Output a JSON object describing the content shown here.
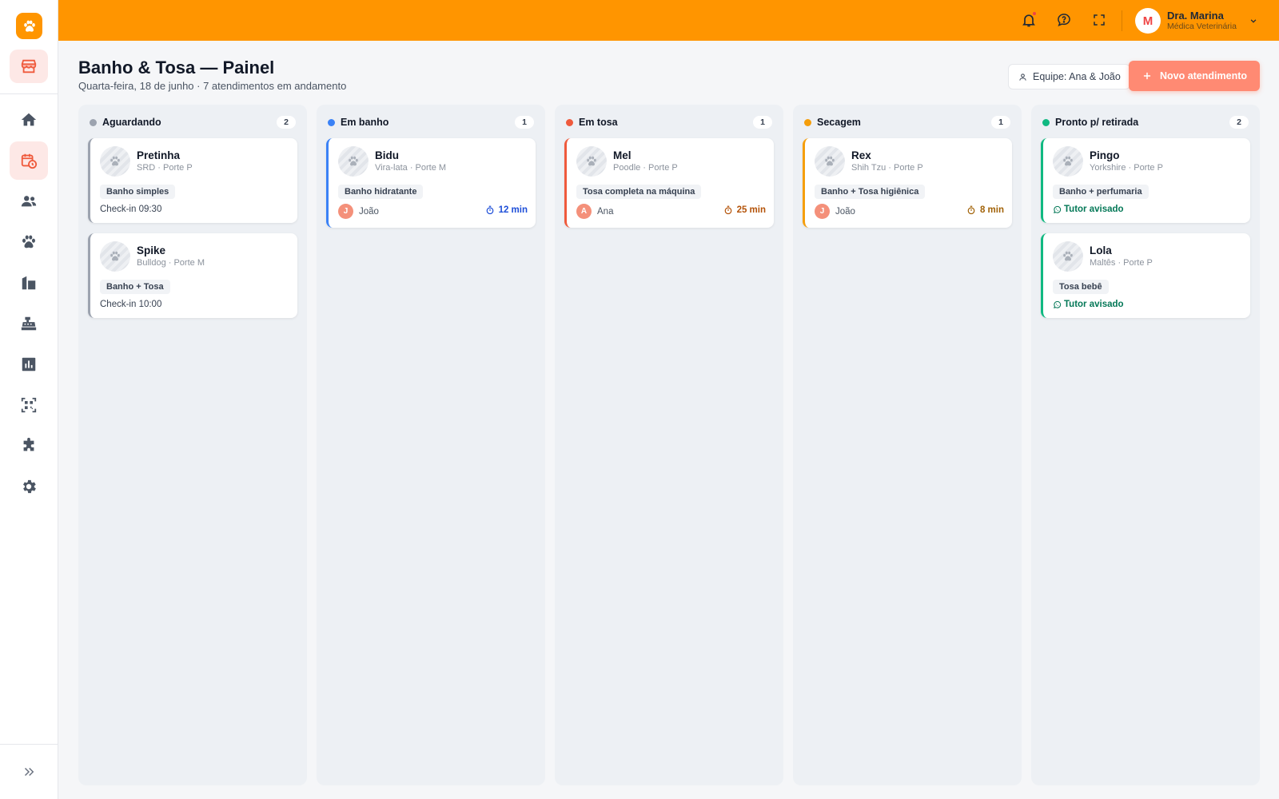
{
  "topbar": {
    "user": {
      "initial": "M",
      "name": "Dra. Marina",
      "role": "Médica Veterinária"
    }
  },
  "sidebar": {
    "items": [
      {
        "icon": "home-icon",
        "active": false
      },
      {
        "icon": "calendar-clock-icon",
        "active": true
      },
      {
        "icon": "users-icon",
        "active": false
      },
      {
        "icon": "paw-icon",
        "active": false
      },
      {
        "icon": "building-icon",
        "active": false
      },
      {
        "icon": "cash-register-icon",
        "active": false
      },
      {
        "icon": "chart-icon",
        "active": false
      },
      {
        "icon": "qr-code-icon",
        "active": false
      },
      {
        "icon": "puzzle-icon",
        "active": false
      },
      {
        "icon": "gear-icon",
        "active": false
      }
    ]
  },
  "header": {
    "title": "Banho & Tosa — Painel",
    "subtitle": "Quarta-feira, 18 de junho · 7 atendimentos em andamento",
    "team_label": "Equipe: Ana & João",
    "new_label": "Novo atendimento"
  },
  "columns": [
    {
      "title": "Aguardando",
      "count": "2",
      "color": "#9ca3af",
      "cards": [
        {
          "name": "Pretinha",
          "meta": "SRD · Porte P",
          "service": "Banho simples",
          "checkin": "Check-in 09:30"
        },
        {
          "name": "Spike",
          "meta": "Bulldog · Porte M",
          "service": "Banho + Tosa",
          "checkin": "Check-in 10:00"
        }
      ]
    },
    {
      "title": "Em banho",
      "count": "1",
      "color": "#3b82f6",
      "cards": [
        {
          "name": "Bidu",
          "meta": "Vira-lata · Porte M",
          "service": "Banho hidratante",
          "groomer_initial": "J",
          "groomer": "João",
          "timer": "12 min",
          "timer_color": "#1d4ed8"
        }
      ]
    },
    {
      "title": "Em tosa",
      "count": "1",
      "color": "#ef5a3c",
      "cards": [
        {
          "name": "Mel",
          "meta": "Poodle · Porte P",
          "service": "Tosa completa na máquina",
          "groomer_initial": "A",
          "groomer": "Ana",
          "timer": "25 min",
          "timer_color": "#b45309"
        }
      ]
    },
    {
      "title": "Secagem",
      "count": "1",
      "color": "#f59e0b",
      "cards": [
        {
          "name": "Rex",
          "meta": "Shih Tzu · Porte P",
          "service": "Banho + Tosa higiênica",
          "groomer_initial": "J",
          "groomer": "João",
          "timer": "8 min",
          "timer_color": "#a16207"
        }
      ]
    },
    {
      "title": "Pronto p/ retirada",
      "count": "2",
      "color": "#10b981",
      "cards": [
        {
          "name": "Pingo",
          "meta": "Yorkshire · Porte P",
          "service": "Banho + perfumaria",
          "notified": "Tutor avisado"
        },
        {
          "name": "Lola",
          "meta": "Maltês · Porte P",
          "service": "Tosa bebê",
          "notified": "Tutor avisado"
        }
      ]
    }
  ]
}
